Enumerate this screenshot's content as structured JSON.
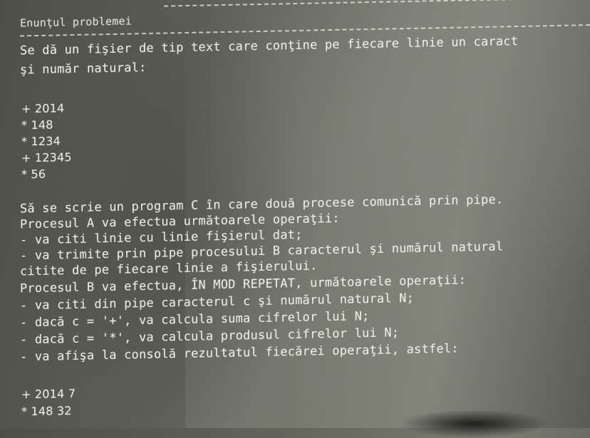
{
  "title": "Enunţul problemei",
  "lines": [
    "Se dă un fişier de tip text care conţine pe fiecare linie un caract",
    "şi număr natural:",
    "+ 2014",
    "* 148",
    "* 1234",
    "+ 12345",
    "* 56",
    "Să se scrie un program C în care două procese comunică prin pipe.",
    "Procesul A va efectua următoarele operaţii:",
    "- va citi linie cu linie fişierul dat;",
    "- va trimite prin pipe procesului B caracterul şi numărul natural",
    "citite de pe fiecare linie a fişierului.",
    "Procesul B va efectua, ÎN MOD REPETAT, următoarele operaţii:",
    "- va citi din pipe caracterul c şi numărul natural N;",
    "- dacă c = '+', va calcula suma cifrelor lui N;",
    "- dacă c = '*', va calcula produsul cifrelor lui N;",
    "- va afişa la consolă rezultatul fiecărei operaţii, astfel:",
    "+ 2014 7",
    "* 148 32"
  ]
}
